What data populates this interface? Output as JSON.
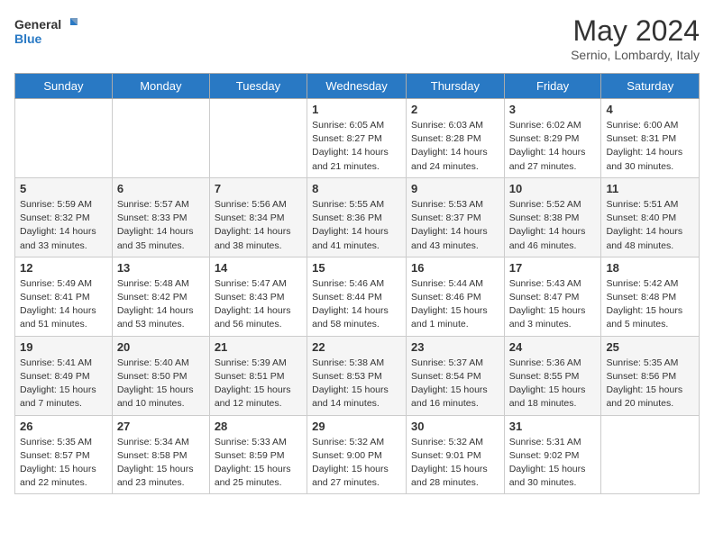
{
  "header": {
    "logo_general": "General",
    "logo_blue": "Blue",
    "month_title": "May 2024",
    "location": "Sernio, Lombardy, Italy"
  },
  "weekdays": [
    "Sunday",
    "Monday",
    "Tuesday",
    "Wednesday",
    "Thursday",
    "Friday",
    "Saturday"
  ],
  "weeks": [
    [
      {
        "day": "",
        "sunrise": "",
        "sunset": "",
        "daylight": ""
      },
      {
        "day": "",
        "sunrise": "",
        "sunset": "",
        "daylight": ""
      },
      {
        "day": "",
        "sunrise": "",
        "sunset": "",
        "daylight": ""
      },
      {
        "day": "1",
        "sunrise": "Sunrise: 6:05 AM",
        "sunset": "Sunset: 8:27 PM",
        "daylight": "Daylight: 14 hours and 21 minutes."
      },
      {
        "day": "2",
        "sunrise": "Sunrise: 6:03 AM",
        "sunset": "Sunset: 8:28 PM",
        "daylight": "Daylight: 14 hours and 24 minutes."
      },
      {
        "day": "3",
        "sunrise": "Sunrise: 6:02 AM",
        "sunset": "Sunset: 8:29 PM",
        "daylight": "Daylight: 14 hours and 27 minutes."
      },
      {
        "day": "4",
        "sunrise": "Sunrise: 6:00 AM",
        "sunset": "Sunset: 8:31 PM",
        "daylight": "Daylight: 14 hours and 30 minutes."
      }
    ],
    [
      {
        "day": "5",
        "sunrise": "Sunrise: 5:59 AM",
        "sunset": "Sunset: 8:32 PM",
        "daylight": "Daylight: 14 hours and 33 minutes."
      },
      {
        "day": "6",
        "sunrise": "Sunrise: 5:57 AM",
        "sunset": "Sunset: 8:33 PM",
        "daylight": "Daylight: 14 hours and 35 minutes."
      },
      {
        "day": "7",
        "sunrise": "Sunrise: 5:56 AM",
        "sunset": "Sunset: 8:34 PM",
        "daylight": "Daylight: 14 hours and 38 minutes."
      },
      {
        "day": "8",
        "sunrise": "Sunrise: 5:55 AM",
        "sunset": "Sunset: 8:36 PM",
        "daylight": "Daylight: 14 hours and 41 minutes."
      },
      {
        "day": "9",
        "sunrise": "Sunrise: 5:53 AM",
        "sunset": "Sunset: 8:37 PM",
        "daylight": "Daylight: 14 hours and 43 minutes."
      },
      {
        "day": "10",
        "sunrise": "Sunrise: 5:52 AM",
        "sunset": "Sunset: 8:38 PM",
        "daylight": "Daylight: 14 hours and 46 minutes."
      },
      {
        "day": "11",
        "sunrise": "Sunrise: 5:51 AM",
        "sunset": "Sunset: 8:40 PM",
        "daylight": "Daylight: 14 hours and 48 minutes."
      }
    ],
    [
      {
        "day": "12",
        "sunrise": "Sunrise: 5:49 AM",
        "sunset": "Sunset: 8:41 PM",
        "daylight": "Daylight: 14 hours and 51 minutes."
      },
      {
        "day": "13",
        "sunrise": "Sunrise: 5:48 AM",
        "sunset": "Sunset: 8:42 PM",
        "daylight": "Daylight: 14 hours and 53 minutes."
      },
      {
        "day": "14",
        "sunrise": "Sunrise: 5:47 AM",
        "sunset": "Sunset: 8:43 PM",
        "daylight": "Daylight: 14 hours and 56 minutes."
      },
      {
        "day": "15",
        "sunrise": "Sunrise: 5:46 AM",
        "sunset": "Sunset: 8:44 PM",
        "daylight": "Daylight: 14 hours and 58 minutes."
      },
      {
        "day": "16",
        "sunrise": "Sunrise: 5:44 AM",
        "sunset": "Sunset: 8:46 PM",
        "daylight": "Daylight: 15 hours and 1 minute."
      },
      {
        "day": "17",
        "sunrise": "Sunrise: 5:43 AM",
        "sunset": "Sunset: 8:47 PM",
        "daylight": "Daylight: 15 hours and 3 minutes."
      },
      {
        "day": "18",
        "sunrise": "Sunrise: 5:42 AM",
        "sunset": "Sunset: 8:48 PM",
        "daylight": "Daylight: 15 hours and 5 minutes."
      }
    ],
    [
      {
        "day": "19",
        "sunrise": "Sunrise: 5:41 AM",
        "sunset": "Sunset: 8:49 PM",
        "daylight": "Daylight: 15 hours and 7 minutes."
      },
      {
        "day": "20",
        "sunrise": "Sunrise: 5:40 AM",
        "sunset": "Sunset: 8:50 PM",
        "daylight": "Daylight: 15 hours and 10 minutes."
      },
      {
        "day": "21",
        "sunrise": "Sunrise: 5:39 AM",
        "sunset": "Sunset: 8:51 PM",
        "daylight": "Daylight: 15 hours and 12 minutes."
      },
      {
        "day": "22",
        "sunrise": "Sunrise: 5:38 AM",
        "sunset": "Sunset: 8:53 PM",
        "daylight": "Daylight: 15 hours and 14 minutes."
      },
      {
        "day": "23",
        "sunrise": "Sunrise: 5:37 AM",
        "sunset": "Sunset: 8:54 PM",
        "daylight": "Daylight: 15 hours and 16 minutes."
      },
      {
        "day": "24",
        "sunrise": "Sunrise: 5:36 AM",
        "sunset": "Sunset: 8:55 PM",
        "daylight": "Daylight: 15 hours and 18 minutes."
      },
      {
        "day": "25",
        "sunrise": "Sunrise: 5:35 AM",
        "sunset": "Sunset: 8:56 PM",
        "daylight": "Daylight: 15 hours and 20 minutes."
      }
    ],
    [
      {
        "day": "26",
        "sunrise": "Sunrise: 5:35 AM",
        "sunset": "Sunset: 8:57 PM",
        "daylight": "Daylight: 15 hours and 22 minutes."
      },
      {
        "day": "27",
        "sunrise": "Sunrise: 5:34 AM",
        "sunset": "Sunset: 8:58 PM",
        "daylight": "Daylight: 15 hours and 23 minutes."
      },
      {
        "day": "28",
        "sunrise": "Sunrise: 5:33 AM",
        "sunset": "Sunset: 8:59 PM",
        "daylight": "Daylight: 15 hours and 25 minutes."
      },
      {
        "day": "29",
        "sunrise": "Sunrise: 5:32 AM",
        "sunset": "Sunset: 9:00 PM",
        "daylight": "Daylight: 15 hours and 27 minutes."
      },
      {
        "day": "30",
        "sunrise": "Sunrise: 5:32 AM",
        "sunset": "Sunset: 9:01 PM",
        "daylight": "Daylight: 15 hours and 28 minutes."
      },
      {
        "day": "31",
        "sunrise": "Sunrise: 5:31 AM",
        "sunset": "Sunset: 9:02 PM",
        "daylight": "Daylight: 15 hours and 30 minutes."
      },
      {
        "day": "",
        "sunrise": "",
        "sunset": "",
        "daylight": ""
      }
    ]
  ]
}
